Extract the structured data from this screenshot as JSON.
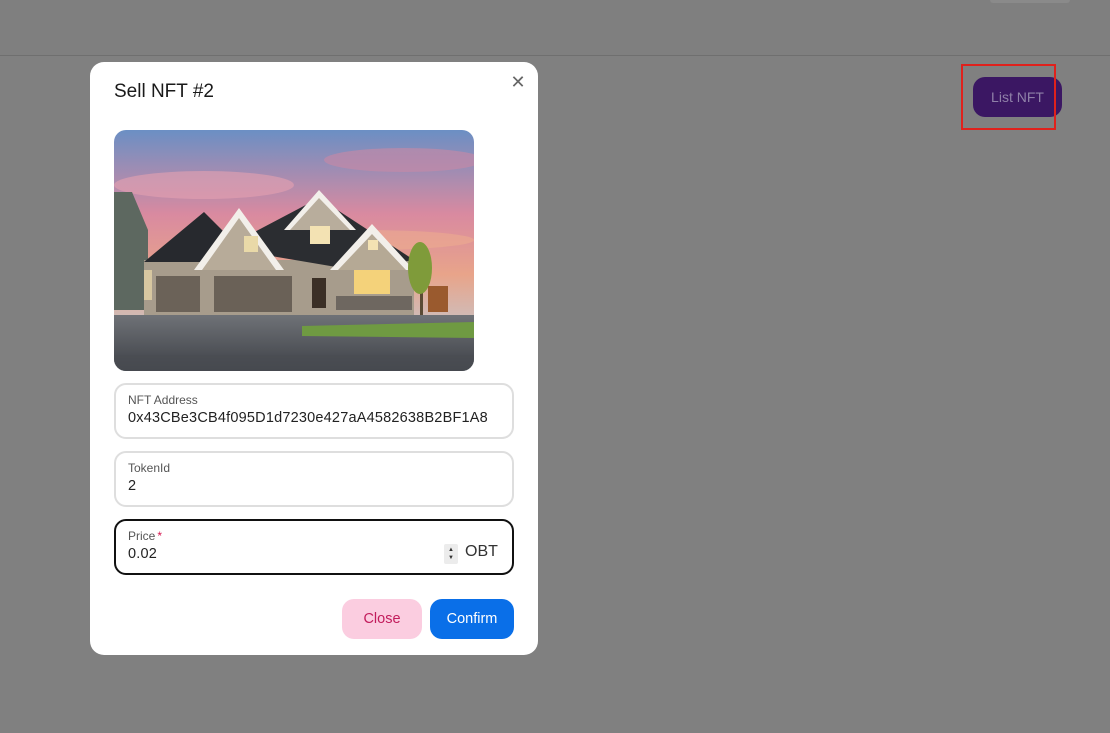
{
  "page": {
    "header_button_label": "List NFT"
  },
  "modal": {
    "title": "Sell NFT #2",
    "close_icon": "close-icon",
    "image": "house-photo",
    "fields": {
      "nft_address": {
        "label": "NFT Address",
        "value": "0x43CBe3CB4f095D1d7230e427aA4582638B2BF1A8"
      },
      "token_id": {
        "label": "TokenId",
        "value": "2"
      },
      "price": {
        "label": "Price",
        "required_mark": "*",
        "value": "0.02",
        "unit": "OBT"
      }
    },
    "buttons": {
      "close": "Close",
      "confirm": "Confirm"
    }
  },
  "colors": {
    "overlay": "#808080",
    "list_button_bg": "#3b1763",
    "highlight": "#e0211c",
    "close_button_bg": "#fbcde0",
    "close_button_text": "#c21c5c",
    "confirm_button_bg": "#0a6fe8"
  }
}
